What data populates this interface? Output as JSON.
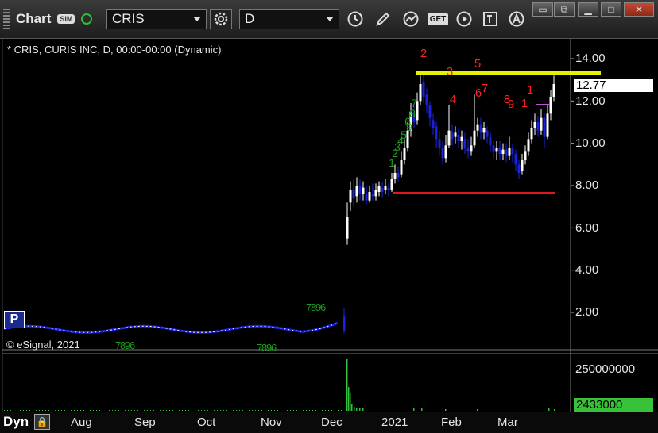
{
  "toolbar": {
    "app_title": "Chart",
    "sim_badge": "SIM",
    "symbol_value": "CRIS",
    "interval_value": "D",
    "get_label": "GET"
  },
  "chart_header": {
    "description": "* CRIS, CURIS INC, D, 00:00-00:00 (Dynamic)",
    "copyright": "© eSignal, 2021",
    "p_badge": "P"
  },
  "price_axis": {
    "ticks": [
      "14.00",
      "12.00",
      "10.00",
      "8.00",
      "6.00",
      "4.00",
      "2.00"
    ],
    "last_price": "12.77"
  },
  "volume_axis": {
    "tick": "250000000",
    "last_volume": "2433000"
  },
  "time_axis": {
    "labels": [
      "Aug",
      "Sep",
      "Oct",
      "Nov",
      "Dec",
      "2021",
      "Feb",
      "Mar"
    ]
  },
  "bottom": {
    "mode_label": "Dyn"
  },
  "annotations": {
    "red_labels": [
      "2",
      "3",
      "4",
      "5",
      "6",
      "7",
      "8",
      "9",
      "1",
      "1"
    ],
    "green_labels": [
      "7",
      "8",
      "9",
      "6",
      "5",
      "4",
      "3",
      "2",
      "1"
    ]
  },
  "colors": {
    "background": "#000000",
    "bull_candle": "#ffffff",
    "bear_candle": "#1a22e0",
    "resistance_line": "#e6f000",
    "support_line": "#e01818",
    "red_label": "#ff2020",
    "green_label": "#1f9a1f",
    "volume_bar": "#34c13a"
  }
}
